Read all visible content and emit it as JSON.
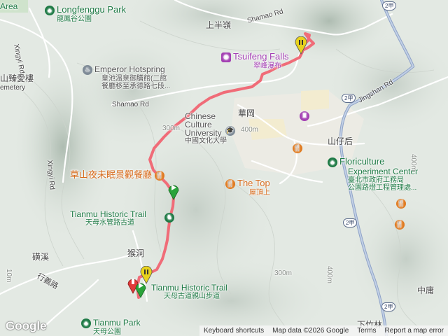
{
  "map": {
    "places": {
      "longfenggu_park": {
        "name": "Longfenggu Park",
        "zh": "龍鳳谷公園"
      },
      "emperor_hotspring": {
        "name": "Emperor Hotspring",
        "zh1": "皇池溫泉御膳館(二館",
        "zh2": "餐廳移至承德路七段..."
      },
      "tsuifeng": {
        "name": "Tsuifeng Falls",
        "zh": "翠峰瀑布"
      },
      "culture_univ": {
        "name1": "Chinese",
        "name2": "Culture",
        "name3": "University",
        "zh": "中國文化大學"
      },
      "night_view": {
        "zh": "草山夜未眠景觀餐廳"
      },
      "the_top": {
        "name": "The Top",
        "zh": "屋頂上"
      },
      "tianmu_trail_1": {
        "name": "Tianmu Historic Trail",
        "zh": "天母水管路古道"
      },
      "tianmu_trail_2": {
        "name": "Tianmu Historic Trail",
        "zh": "天母古道親山步道"
      },
      "floriculture": {
        "name1": "Floriculture",
        "name2": "Experiment Center",
        "zh1": "臺北市政府工務局",
        "zh2": "公園路燈工程管理處..."
      },
      "tianmu_park": {
        "name": "Tianmu Park",
        "zh": "天母公園"
      },
      "cemetery_zh": "山臻愛樓",
      "cemetery_en": "emetery",
      "area_label": "Area"
    },
    "towns": {
      "shangbanling": "上半嶺",
      "huagang": "華岡",
      "shanzihou": "山仔后",
      "houdong": "猴洞",
      "qixi": "磺溪",
      "zhongyong": "中庸",
      "xiazhulin": "下竹林"
    },
    "roads": {
      "shamao_top": "Shamao Rd",
      "shamao_mid": "Shamao Rd",
      "xingyi_top": "Xingyi Rd",
      "xingyi_mid": "Xingyi Rd",
      "xingyi_zh": "行義路",
      "jingshan": "Jingshan Rd"
    },
    "shields": [
      "2甲",
      "2甲",
      "2甲",
      "2甲"
    ],
    "elevations": [
      "400m",
      "300m",
      "300m",
      "400m",
      "400m",
      "10m"
    ],
    "colors": {
      "route": "#f06c78",
      "marker_green": "#2aa33a",
      "marker_yellow": "#e8d21c",
      "marker_red": "#e03a3a"
    }
  },
  "footer": {
    "logo": "Google",
    "shortcuts": "Keyboard shortcuts",
    "map_data": "Map data ©2026 Google",
    "terms": "Terms",
    "report": "Report a map error"
  }
}
